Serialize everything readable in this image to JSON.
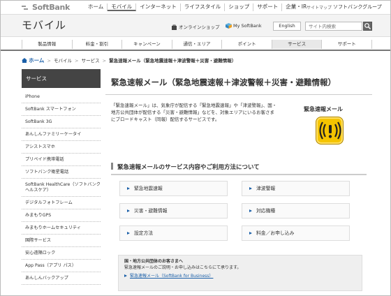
{
  "topbar": {
    "logo": "SoftBank",
    "nav": [
      "ホーム",
      "モバイル",
      "インターネット",
      "ライフスタイル",
      "ショップ",
      "サポート",
      "企業・IR"
    ],
    "nav_active_index": 1,
    "sitemap": "サイトマップ",
    "group": "ソフトバンクグループ"
  },
  "header": {
    "title": "モバイル",
    "online_shop": "オンラインショップ",
    "my_softbank": "My SoftBank",
    "english": "English",
    "search_placeholder": "サイト内検索"
  },
  "subnav": {
    "items": [
      "製品情報",
      "料金・割引",
      "キャンペーン",
      "通信・エリア",
      "ポイント",
      "サービス",
      "サポート"
    ],
    "active_index": 5
  },
  "breadcrumb": {
    "home": "ホーム",
    "items": [
      "モバイル",
      "サービス"
    ],
    "current": "緊急速報メール（緊急地震速報＋津波警報＋災害・避難情報）"
  },
  "sidebar": {
    "heading": "サービス",
    "items": [
      "iPhone",
      "SoftBank スマートフォン",
      "SoftBank 3G",
      "あんしんファミリーケータイ",
      "アシストスマホ",
      "プリペイド携帯電話",
      "ソフトバンク衛星電話",
      "SoftBank HealthCare（ソフトバンク ヘルスケア）",
      "デジタルフォトフレーム",
      "みまもりGPS",
      "みまもりホームセキュリティ",
      "国際サービス",
      "安心遠隔ロック",
      "App Pass（アプリ パス）",
      "あんしんバックアップ"
    ]
  },
  "main": {
    "title": "緊急速報メール（緊急地震速報＋津波警報＋災害・避難情報）",
    "intro": "「緊急速報メール」は、気象庁が配信する「緊急地震速報」や「津波警報」、国・地方公共団体が配信する「災害・避難情報」などを、対象エリアにいるお客さまにブロードキャスト（同報）配信するサービスです。",
    "badge_title": "緊急速報メール",
    "section_title": "緊急速報メールのサービス内容やご利用方法について",
    "links": [
      [
        "緊急地震速報",
        "津波警報"
      ],
      [
        "災害・避難情報",
        "対応機種"
      ],
      [
        "設定方法",
        "料金／お申し込み"
      ]
    ],
    "note": {
      "title": "国・地方公共団体のお客さまへ",
      "text": "緊急速報メールのご説明・お申し込みはこちらにて承ります。",
      "link": "緊急速報メール（SoftBank for Business）"
    }
  },
  "colors": {
    "accent": "#1a5fa8",
    "badge": "#f5c400"
  }
}
